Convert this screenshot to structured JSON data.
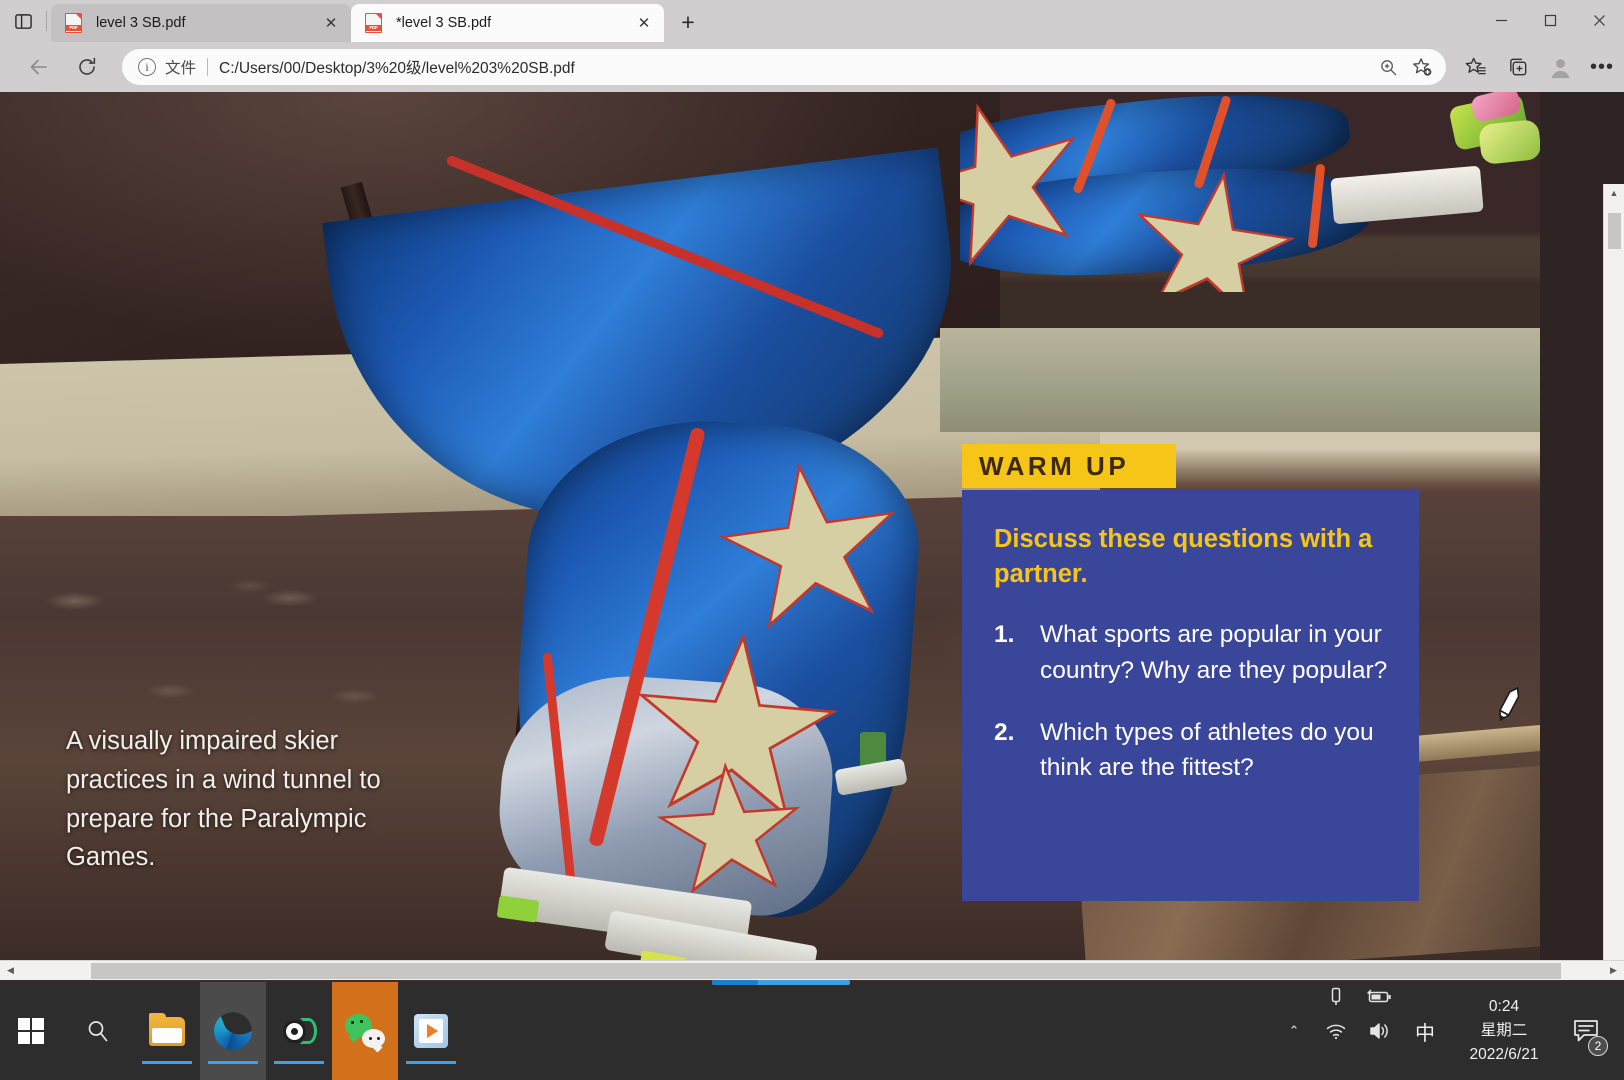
{
  "browser": {
    "tab_preview_icon": "tab-preview-icon",
    "tabs": [
      {
        "title": "level 3 SB.pdf",
        "favicon": "pdf-file-icon",
        "close_label": "✕",
        "active": false
      },
      {
        "title": "*level 3 SB.pdf",
        "favicon": "pdf-file-icon",
        "close_label": "✕",
        "active": true
      }
    ],
    "new_tab_label": "+",
    "window_controls": {
      "minimize": "minimize-icon",
      "maximize": "maximize-icon",
      "close": "close-icon"
    },
    "nav": {
      "back": "back-arrow-icon",
      "refresh": "refresh-icon"
    },
    "address": {
      "info_icon_label": "ⓘ",
      "scheme_label": "文件",
      "url": "C:/Users/00/Desktop/3%20级/level%203%20SB.pdf",
      "zoom_icon": "zoom-in-icon",
      "favorite_icon": "add-favorite-star-icon"
    },
    "toolbar": {
      "favorites_icon": "favorites-list-icon",
      "collections_icon": "collections-icon",
      "profile_icon": "profile-avatar-icon",
      "settings_icon": "more-options-icon",
      "settings_label": "•••"
    }
  },
  "pdf": {
    "caption": "A visually impaired skier practices in a wind tunnel to prepare for the Paralympic Games.",
    "warm_up": {
      "label": "WARM UP",
      "heading": "Discuss these questions with a partner.",
      "questions": [
        {
          "num": "1.",
          "text": "What sports are popular in your country? Why are they popular?"
        },
        {
          "num": "2.",
          "text": "Which types of athletes do you think are the fittest?"
        }
      ]
    },
    "colors": {
      "warm_up_badge_bg": "#f5c518",
      "warm_up_badge_text": "#3c2a08",
      "panel_bg": "#39469a",
      "panel_heading": "#f5c518",
      "panel_text": "#ffffff"
    },
    "scrollbars": {
      "vertical_up": "▲",
      "vertical_down": "▼",
      "horizontal_left": "◀",
      "horizontal_right": "▶"
    },
    "cursor": "pen-cursor-icon"
  },
  "taskbar": {
    "start_label": "start-button",
    "search_label": "search-icon",
    "apps": [
      {
        "name": "file-explorer",
        "icon": "folder-icon",
        "active": false
      },
      {
        "name": "microsoft-edge",
        "icon": "edge-icon",
        "active": true
      },
      {
        "name": "green-app",
        "icon": "green-app-icon",
        "active": false
      },
      {
        "name": "wechat",
        "icon": "wechat-icon",
        "active": true
      },
      {
        "name": "media-player",
        "icon": "media-player-icon",
        "active": false
      }
    ],
    "tray": {
      "chevron": "⌃",
      "pen_icon": "tablet-pen-icon",
      "battery_icon": "battery-charging-icon",
      "wifi_icon": "wifi-icon",
      "volume_icon": "volume-icon",
      "ime_label": "中",
      "time": "0:24",
      "weekday": "星期二",
      "date": "2022/6/21",
      "notification_icon": "notifications-icon",
      "notification_count": "2"
    }
  }
}
